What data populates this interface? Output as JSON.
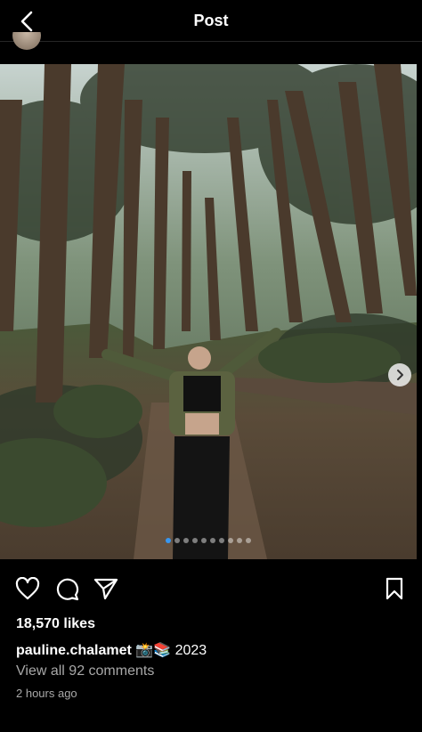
{
  "header": {
    "title": "Post"
  },
  "post": {
    "likes": "18,570 likes",
    "username": "pauline.chalamet",
    "caption_emojis": "📸📚",
    "caption_text": "2023",
    "comments_link": "View all 92 comments",
    "timestamp": "2 hours ago",
    "carousel": {
      "count": 10,
      "active_index": 0
    }
  },
  "icons": {
    "back": "chevron-left-icon",
    "like": "heart-icon",
    "comment": "comment-bubble-icon",
    "share": "paper-plane-icon",
    "save": "bookmark-icon",
    "next": "chevron-right-icon"
  },
  "colors": {
    "background": "#000000",
    "secondary_text": "#a8a8a8",
    "active_dot": "#3897f0"
  }
}
